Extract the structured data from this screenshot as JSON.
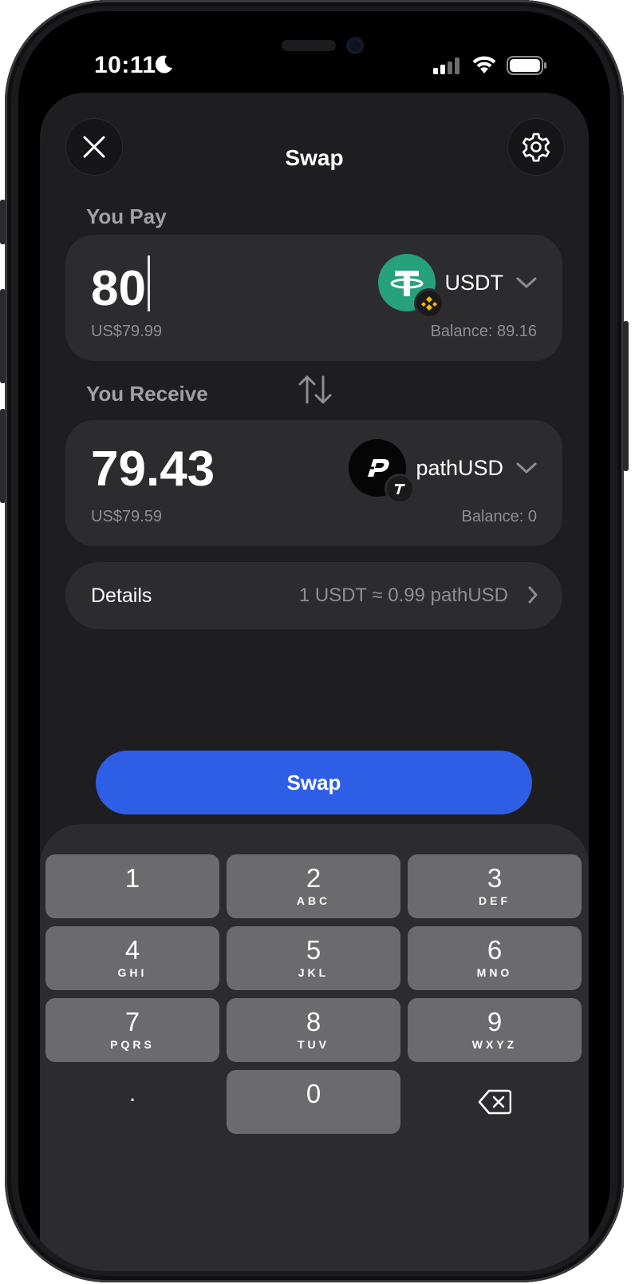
{
  "status_bar": {
    "time": "10:11"
  },
  "header": {
    "title": "Swap",
    "close_icon": "close-icon",
    "settings_icon": "gear-icon"
  },
  "pay": {
    "label": "You Pay",
    "amount": "80",
    "fiat": "US$79.99",
    "token": "USDT",
    "balance": "Balance: 89.16"
  },
  "receive": {
    "label": "You Receive",
    "amount": "79.43",
    "fiat": "US$79.59",
    "token": "pathUSD",
    "balance": "Balance: 0"
  },
  "details": {
    "label": "Details",
    "rate": "1 USDT ≈ 0.99 pathUSD"
  },
  "swap_button": "Swap",
  "colors": {
    "accent": "#2F5EE6",
    "usdt": "#26A17B",
    "bnb": "#F0B90B"
  },
  "keypad": {
    "keys": [
      {
        "num": "1",
        "letters": ""
      },
      {
        "num": "2",
        "letters": "ABC"
      },
      {
        "num": "3",
        "letters": "DEF"
      },
      {
        "num": "4",
        "letters": "GHI"
      },
      {
        "num": "5",
        "letters": "JKL"
      },
      {
        "num": "6",
        "letters": "MNO"
      },
      {
        "num": "7",
        "letters": "PQRS"
      },
      {
        "num": "8",
        "letters": "TUV"
      },
      {
        "num": "9",
        "letters": "WXYZ"
      },
      {
        "num": ".",
        "letters": ""
      },
      {
        "num": "0",
        "letters": ""
      }
    ]
  }
}
